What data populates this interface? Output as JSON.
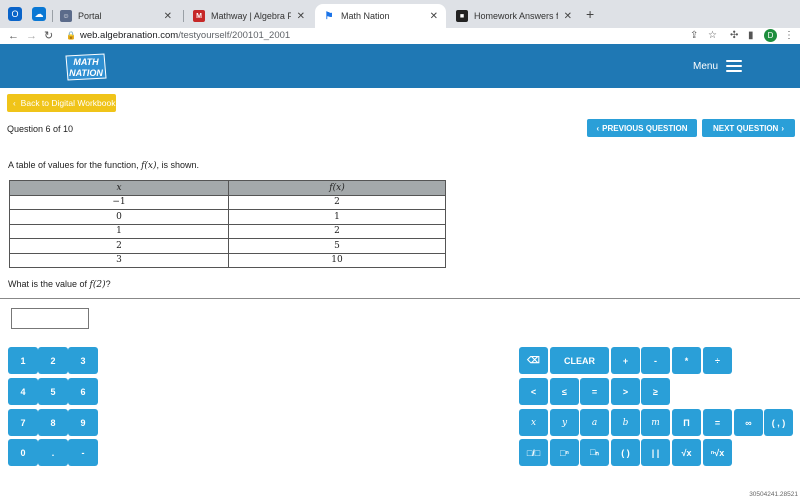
{
  "browser": {
    "tabs": [
      {
        "label": "Portal",
        "active": false
      },
      {
        "label": "Mathway | Algebra Problem Sol",
        "active": false
      },
      {
        "label": "Math Nation",
        "active": true
      },
      {
        "label": "Homework Answers from Subje",
        "active": false
      }
    ],
    "url_domain": "web.algebranation.com",
    "url_path": "/testyourself/200101_2001",
    "profile_initial": "D"
  },
  "header": {
    "logo_line1": "MATH",
    "logo_line2": "NATION",
    "menu_label": "Menu"
  },
  "nav": {
    "back_label": "Back to Digital Workbook",
    "question_counter": "Question 6 of 10",
    "prev_label": "PREVIOUS QUESTION",
    "next_label": "NEXT QUESTION"
  },
  "question": {
    "prompt_pre": "A table of values for the function, ",
    "prompt_func": "f(x)",
    "prompt_post": ", is shown.",
    "table": {
      "headers": [
        "x",
        "f(x)"
      ],
      "rows": [
        [
          "−1",
          "2"
        ],
        [
          "0",
          "1"
        ],
        [
          "1",
          "2"
        ],
        [
          "2",
          "5"
        ],
        [
          "3",
          "10"
        ]
      ]
    },
    "ask_pre": "What is the value of ",
    "ask_func": "f(2)",
    "ask_post": "?",
    "answer_value": ""
  },
  "keypad_numbers": [
    "1",
    "2",
    "3",
    "4",
    "5",
    "6",
    "7",
    "8",
    "9",
    "0",
    ".",
    "-"
  ],
  "keypad_ops": {
    "row1": [
      "⌫",
      "CLEAR",
      "+",
      "-",
      "*",
      "÷"
    ],
    "row2": [
      "<",
      "≤",
      "=",
      ">",
      "≥"
    ],
    "row3": [
      "x",
      "y",
      "a",
      "b",
      "m",
      "Π",
      "=",
      "∞",
      "( , )"
    ],
    "row4": [
      "□/□",
      "□ⁿ",
      "□ₙ",
      "( )",
      "| |",
      "√x",
      "ⁿ√x"
    ]
  },
  "build_id": "30504241.28521"
}
